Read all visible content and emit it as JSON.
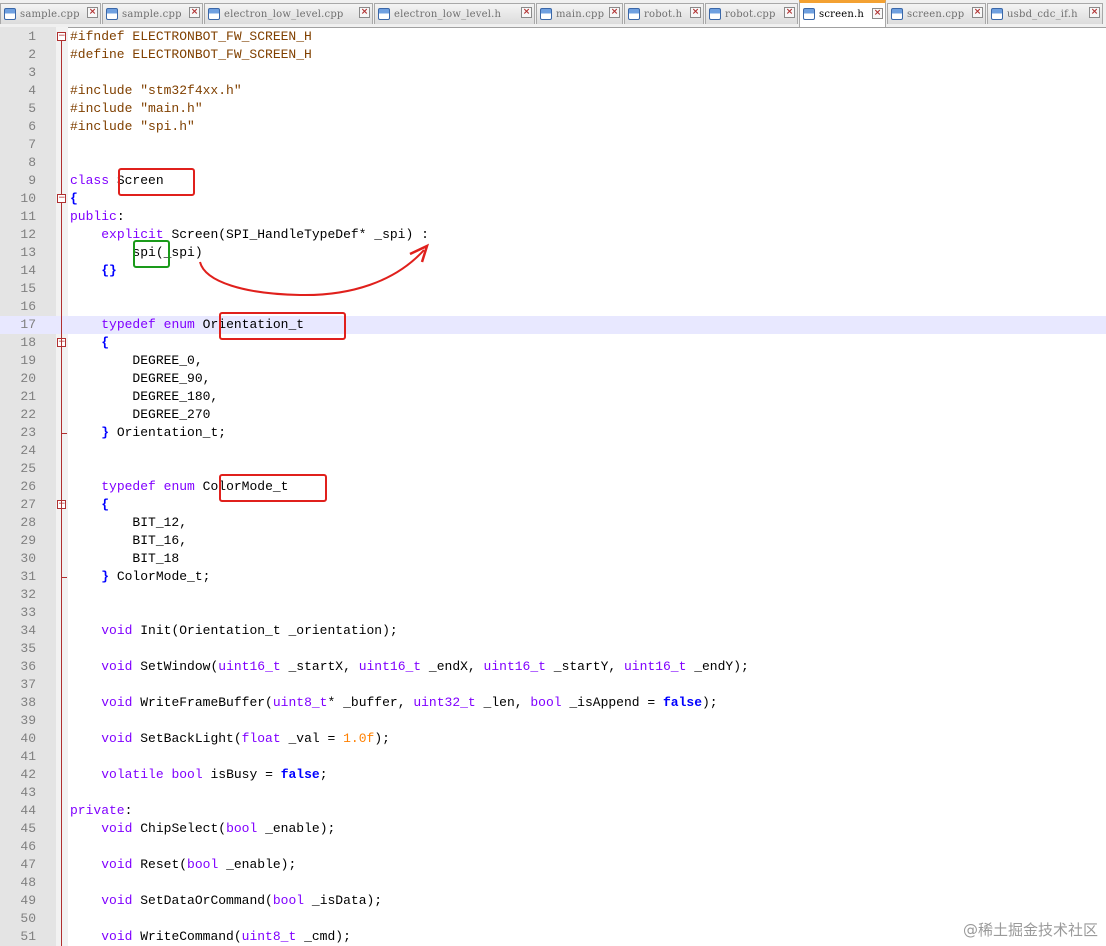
{
  "tabs": [
    {
      "label": "sample.cpp",
      "active": false
    },
    {
      "label": "sample.cpp",
      "active": false
    },
    {
      "label": "electron_low_level.cpp",
      "active": false
    },
    {
      "label": "electron_low_level.h",
      "active": false
    },
    {
      "label": "main.cpp",
      "active": false
    },
    {
      "label": "robot.h",
      "active": false
    },
    {
      "label": "robot.cpp",
      "active": false
    },
    {
      "label": "screen.h",
      "active": true
    },
    {
      "label": "screen.cpp",
      "active": false
    },
    {
      "label": "usbd_cdc_if.h",
      "active": false
    }
  ],
  "code_lines": [
    {
      "n": "1",
      "segs": [
        [
          "pp",
          "#ifndef ELECTRONBOT_FW_SCREEN_H"
        ]
      ]
    },
    {
      "n": "2",
      "segs": [
        [
          "pp",
          "#define ELECTRONBOT_FW_SCREEN_H"
        ]
      ]
    },
    {
      "n": "3",
      "segs": []
    },
    {
      "n": "4",
      "segs": [
        [
          "pp",
          "#include \"stm32f4xx.h\""
        ]
      ]
    },
    {
      "n": "5",
      "segs": [
        [
          "pp",
          "#include \"main.h\""
        ]
      ]
    },
    {
      "n": "6",
      "segs": [
        [
          "pp",
          "#include \"spi.h\""
        ]
      ]
    },
    {
      "n": "7",
      "segs": []
    },
    {
      "n": "8",
      "segs": []
    },
    {
      "n": "9",
      "segs": [
        [
          "kw",
          "class"
        ],
        [
          "",
          " Screen"
        ]
      ]
    },
    {
      "n": "10",
      "segs": [
        [
          "kb",
          "{"
        ]
      ]
    },
    {
      "n": "11",
      "segs": [
        [
          "kw",
          "public"
        ],
        [
          "",
          ":"
        ]
      ]
    },
    {
      "n": "12",
      "segs": [
        [
          "",
          "    "
        ],
        [
          "kw",
          "explicit"
        ],
        [
          "",
          " Screen(SPI_HandleTypeDef* _spi) :"
        ]
      ]
    },
    {
      "n": "13",
      "segs": [
        [
          "",
          "        spi(_spi)"
        ]
      ]
    },
    {
      "n": "14",
      "segs": [
        [
          "",
          "    "
        ],
        [
          "kb",
          "{}"
        ]
      ]
    },
    {
      "n": "15",
      "segs": []
    },
    {
      "n": "16",
      "segs": []
    },
    {
      "n": "17",
      "segs": [
        [
          "",
          "    "
        ],
        [
          "kw",
          "typedef"
        ],
        [
          "",
          " "
        ],
        [
          "kw",
          "enum"
        ],
        [
          "",
          " Orientation_t"
        ]
      ]
    },
    {
      "n": "18",
      "segs": [
        [
          "",
          "    "
        ],
        [
          "kb",
          "{"
        ]
      ]
    },
    {
      "n": "19",
      "segs": [
        [
          "",
          "        DEGREE_0,"
        ]
      ]
    },
    {
      "n": "20",
      "segs": [
        [
          "",
          "        DEGREE_90,"
        ]
      ]
    },
    {
      "n": "21",
      "segs": [
        [
          "",
          "        DEGREE_180,"
        ]
      ]
    },
    {
      "n": "22",
      "segs": [
        [
          "",
          "        DEGREE_270"
        ]
      ]
    },
    {
      "n": "23",
      "segs": [
        [
          "",
          "    "
        ],
        [
          "kb",
          "}"
        ],
        [
          "",
          " Orientation_t;"
        ]
      ]
    },
    {
      "n": "24",
      "segs": []
    },
    {
      "n": "25",
      "segs": []
    },
    {
      "n": "26",
      "segs": [
        [
          "",
          "    "
        ],
        [
          "kw",
          "typedef"
        ],
        [
          "",
          " "
        ],
        [
          "kw",
          "enum"
        ],
        [
          "",
          " ColorMode_t"
        ]
      ]
    },
    {
      "n": "27",
      "segs": [
        [
          "",
          "    "
        ],
        [
          "kb",
          "{"
        ]
      ]
    },
    {
      "n": "28",
      "segs": [
        [
          "",
          "        BIT_12,"
        ]
      ]
    },
    {
      "n": "29",
      "segs": [
        [
          "",
          "        BIT_16,"
        ]
      ]
    },
    {
      "n": "30",
      "segs": [
        [
          "",
          "        BIT_18"
        ]
      ]
    },
    {
      "n": "31",
      "segs": [
        [
          "",
          "    "
        ],
        [
          "kb",
          "}"
        ],
        [
          "",
          " ColorMode_t;"
        ]
      ]
    },
    {
      "n": "32",
      "segs": []
    },
    {
      "n": "33",
      "segs": []
    },
    {
      "n": "34",
      "segs": [
        [
          "",
          "    "
        ],
        [
          "kw",
          "void"
        ],
        [
          "",
          " Init(Orientation_t _orientation);"
        ]
      ]
    },
    {
      "n": "35",
      "segs": []
    },
    {
      "n": "36",
      "segs": [
        [
          "",
          "    "
        ],
        [
          "kw",
          "void"
        ],
        [
          "",
          " SetWindow("
        ],
        [
          "kw",
          "uint16_t"
        ],
        [
          "",
          " _startX, "
        ],
        [
          "kw",
          "uint16_t"
        ],
        [
          "",
          " _endX, "
        ],
        [
          "kw",
          "uint16_t"
        ],
        [
          "",
          " _startY, "
        ],
        [
          "kw",
          "uint16_t"
        ],
        [
          "",
          " _endY);"
        ]
      ]
    },
    {
      "n": "37",
      "segs": []
    },
    {
      "n": "38",
      "segs": [
        [
          "",
          "    "
        ],
        [
          "kw",
          "void"
        ],
        [
          "",
          " WriteFrameBuffer("
        ],
        [
          "kw",
          "uint8_t"
        ],
        [
          "",
          "* _buffer, "
        ],
        [
          "kw",
          "uint32_t"
        ],
        [
          "",
          " _len, "
        ],
        [
          "kw",
          "bool"
        ],
        [
          "",
          " _isAppend = "
        ],
        [
          "kb",
          "false"
        ],
        [
          "",
          ");"
        ]
      ]
    },
    {
      "n": "39",
      "segs": []
    },
    {
      "n": "40",
      "segs": [
        [
          "",
          "    "
        ],
        [
          "kw",
          "void"
        ],
        [
          "",
          " SetBackLight("
        ],
        [
          "kw",
          "float"
        ],
        [
          "",
          " _val = "
        ],
        [
          "num",
          "1.0f"
        ],
        [
          "",
          ");"
        ]
      ]
    },
    {
      "n": "41",
      "segs": []
    },
    {
      "n": "42",
      "segs": [
        [
          "",
          "    "
        ],
        [
          "kw",
          "volatile"
        ],
        [
          "",
          " "
        ],
        [
          "kw",
          "bool"
        ],
        [
          "",
          " isBusy = "
        ],
        [
          "kb",
          "false"
        ],
        [
          "",
          ";"
        ]
      ]
    },
    {
      "n": "43",
      "segs": []
    },
    {
      "n": "44",
      "segs": [
        [
          "kw",
          "private"
        ],
        [
          "",
          ":"
        ]
      ]
    },
    {
      "n": "45",
      "segs": [
        [
          "",
          "    "
        ],
        [
          "kw",
          "void"
        ],
        [
          "",
          " ChipSelect("
        ],
        [
          "kw",
          "bool"
        ],
        [
          "",
          " _enable);"
        ]
      ]
    },
    {
      "n": "46",
      "segs": []
    },
    {
      "n": "47",
      "segs": [
        [
          "",
          "    "
        ],
        [
          "kw",
          "void"
        ],
        [
          "",
          " Reset("
        ],
        [
          "kw",
          "bool"
        ],
        [
          "",
          " _enable);"
        ]
      ]
    },
    {
      "n": "48",
      "segs": []
    },
    {
      "n": "49",
      "segs": [
        [
          "",
          "    "
        ],
        [
          "kw",
          "void"
        ],
        [
          "",
          " SetDataOrCommand("
        ],
        [
          "kw",
          "bool"
        ],
        [
          "",
          " _isData);"
        ]
      ]
    },
    {
      "n": "50",
      "segs": []
    },
    {
      "n": "51",
      "segs": [
        [
          "",
          "    "
        ],
        [
          "kw",
          "void"
        ],
        [
          "",
          " WriteCommand("
        ],
        [
          "kw",
          "uint8_t"
        ],
        [
          "",
          " _cmd);"
        ]
      ]
    }
  ],
  "current_line": "17",
  "watermark": "@稀土掘金技术社区",
  "colors": {
    "keyword": "#8000ff",
    "brace": "#0000ff",
    "preprocessor": "#804000",
    "number": "#ff8000",
    "current_line_bg": "#e8e8ff",
    "annotation_red": "#e0201c",
    "annotation_green": "#1a9a1a"
  }
}
